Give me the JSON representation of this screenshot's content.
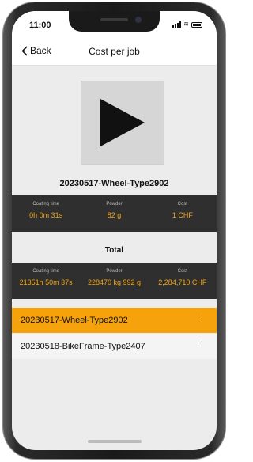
{
  "status_bar": {
    "time": "11:00",
    "icons": [
      "signal-icon",
      "wifi-icon",
      "battery-icon"
    ]
  },
  "nav": {
    "back_label": "Back",
    "title": "Cost per job"
  },
  "media": {
    "icon": "play-icon"
  },
  "job": {
    "name": "20230517-Wheel-Type2902",
    "stats": [
      {
        "label": "Coating time",
        "value": "0h 0m 31s"
      },
      {
        "label": "Powder",
        "value": "82 g"
      },
      {
        "label": "Cost",
        "value": "1 CHF"
      }
    ]
  },
  "total": {
    "label": "Total",
    "stats": [
      {
        "label": "Coating time",
        "value": "21351h 50m 37s"
      },
      {
        "label": "Powder",
        "value": "228470 kg 992 g"
      },
      {
        "label": "Cost",
        "value": "2,284,710 CHF"
      }
    ]
  },
  "jobs_list": [
    {
      "name": "20230517-Wheel-Type2902",
      "selected": true,
      "more": "⋮"
    },
    {
      "name": "20230518-BikeFrame-Type2407",
      "selected": false,
      "more": "⋮"
    }
  ],
  "colors": {
    "accent": "#f5a20c",
    "value_text": "#f2a516",
    "stats_bg": "#2f2f2f",
    "screen_bg": "#ececec"
  }
}
